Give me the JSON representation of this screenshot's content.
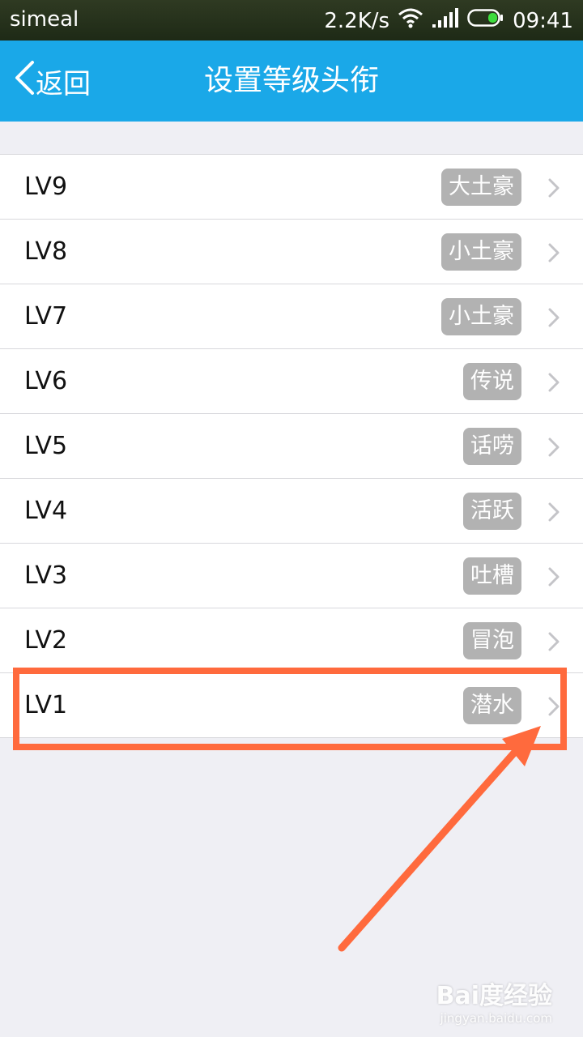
{
  "status_bar": {
    "carrier": "simeal",
    "speed": "2.2K/s",
    "time": "09:41"
  },
  "nav": {
    "back_label": "返回",
    "title": "设置等级头衔"
  },
  "levels": [
    {
      "level": "LV9",
      "title": "大土豪"
    },
    {
      "level": "LV8",
      "title": "小土豪"
    },
    {
      "level": "LV7",
      "title": "小土豪"
    },
    {
      "level": "LV6",
      "title": "传说"
    },
    {
      "level": "LV5",
      "title": "话唠"
    },
    {
      "level": "LV4",
      "title": "活跃"
    },
    {
      "level": "LV3",
      "title": "吐槽"
    },
    {
      "level": "LV2",
      "title": "冒泡"
    },
    {
      "level": "LV1",
      "title": "潜水"
    }
  ],
  "watermark": {
    "logo": "Bai度经验",
    "url": "jingyan.baidu.com"
  },
  "colors": {
    "nav_bg": "#1aa8e8",
    "badge_bg": "#b2b2b2",
    "highlight": "#ff6a3d"
  }
}
